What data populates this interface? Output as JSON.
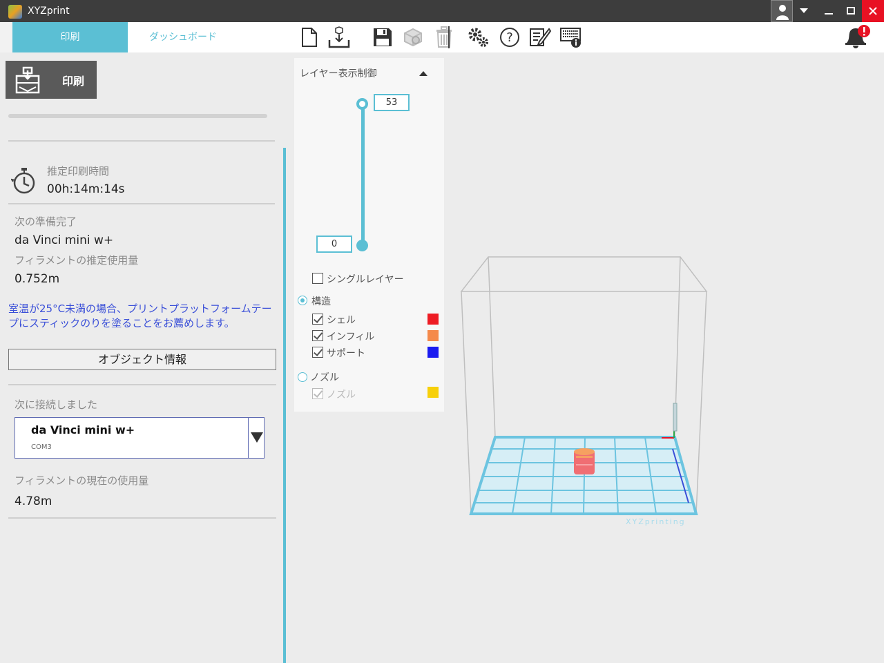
{
  "window": {
    "title": "XYZprint"
  },
  "tabs": {
    "print": "印刷",
    "dashboard": "ダッシュボード"
  },
  "toolbar": [
    "new-file-icon",
    "import-icon",
    "save-icon",
    "object-icon",
    "trash-icon",
    "settings-icon",
    "help-icon",
    "edit-icon",
    "keyboard-info-icon"
  ],
  "left": {
    "print_button": "印刷",
    "est_time_label": "推定印刷時間",
    "est_time_value": "00h:14m:14s",
    "ready_label": "次の準備完了",
    "ready_value": "da Vinci mini w+",
    "filament_est_label": "フィラメントの推定使用量",
    "filament_est_value": "0.752m",
    "notice": "室温が25°C未満の場合、プリントプラットフォームテープにスティックのりを塗ることをお薦めします。",
    "object_info_button": "オブジェクト情報",
    "connected_label": "次に接続しました",
    "printer_name": "da Vinci mini w+",
    "printer_port": "COM3",
    "filament_current_label": "フィラメントの現在の使用量",
    "filament_current_value": "4.78m"
  },
  "layer_panel": {
    "title": "レイヤー表示制御",
    "top_value": "53",
    "bottom_value": "0",
    "single_layer": "シングルレイヤー",
    "structure": "構造",
    "shell": "シェル",
    "infill": "インフィル",
    "support": "サポート",
    "nozzle_radio": "ノズル",
    "nozzle_check": "ノズル",
    "colors": {
      "shell": "#ee1c24",
      "infill": "#f58a4b",
      "support": "#1b1bf0",
      "nozzle": "#f7d00a"
    }
  },
  "viewport": {
    "watermark": "XYZprinting"
  },
  "colors": {
    "accent": "#5bbfd4",
    "notice": "#3a4fd8",
    "close": "#e81123"
  }
}
